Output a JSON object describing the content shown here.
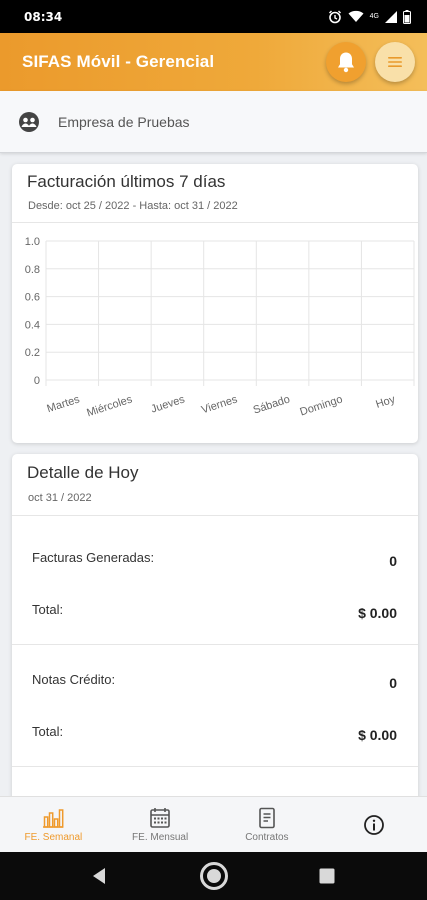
{
  "status_bar": {
    "time": "08:34",
    "network": "4G"
  },
  "app_bar": {
    "title": "SIFAS Móvil - Gerencial"
  },
  "company": {
    "name": "Empresa de Pruebas"
  },
  "billing_card": {
    "title": "Facturación últimos 7 días",
    "subtitle": "Desde: oct 25 / 2022 - Hasta: oct 31 / 2022"
  },
  "chart_data": {
    "type": "line",
    "categories": [
      "Martes",
      "Miércoles",
      "Jueves",
      "Viernes",
      "Sábado",
      "Domingo",
      "Hoy"
    ],
    "series": [
      {
        "values": [
          0,
          0,
          0,
          0,
          0,
          0,
          0
        ]
      }
    ],
    "yticks": [
      "1.0",
      "0.8",
      "0.6",
      "0.4",
      "0.2",
      "0"
    ],
    "ylim": [
      0,
      1
    ],
    "grid": true,
    "accent": "#ef9a2c"
  },
  "detail_card": {
    "title": "Detalle de Hoy",
    "date": "oct 31 / 2022",
    "invoices_label": "Facturas Generadas:",
    "invoices_count": "0",
    "invoices_total_label": "Total:",
    "invoices_total": "$ 0.00",
    "credit_notes_label": "Notas Crédito:",
    "credit_notes_count": "0",
    "credit_notes_total_label": "Total:",
    "credit_notes_total": "$ 0.00"
  },
  "bottom_nav": {
    "weekly": "FE. Semanal",
    "monthly": "FE. Mensual",
    "contracts": "Contratos"
  },
  "colors": {
    "brand": "#ef9a2c",
    "brand_light": "#f9e0a9"
  }
}
